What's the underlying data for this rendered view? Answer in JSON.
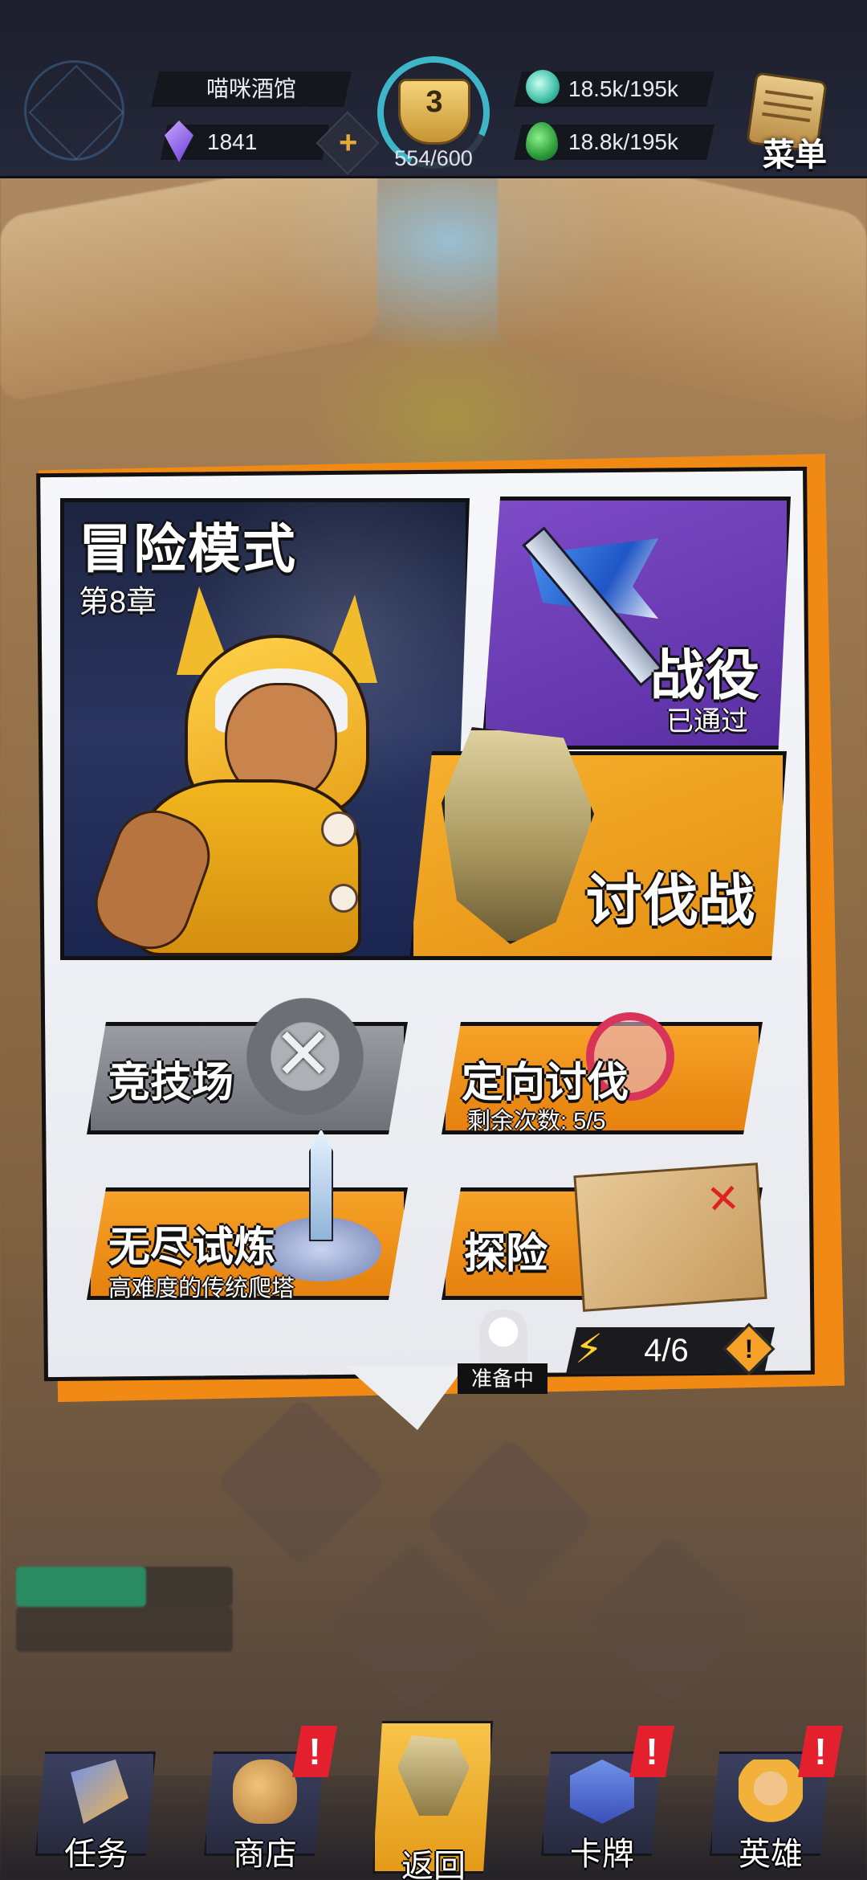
{
  "hud": {
    "tavern_name": "喵咪酒馆",
    "gems": "1841",
    "plus_label": "+",
    "trophy_level": "3",
    "trophy_progress": "554/600",
    "resource_1": "18.5k/195k",
    "resource_2": "18.8k/195k",
    "menu_label": "菜单"
  },
  "adventure": {
    "title": "冒险模式",
    "chapter": "第8章"
  },
  "campaign": {
    "title": "战役",
    "status": "已通过"
  },
  "subjugation": {
    "title": "讨伐战"
  },
  "modes": {
    "arena": {
      "label": "竞技场"
    },
    "directed": {
      "label": "定向讨伐",
      "sub": "剩余次数: 5/5"
    },
    "endless": {
      "label": "无尽试炼",
      "sub": "高难度的传统爬塔"
    },
    "explore": {
      "label": "探险"
    }
  },
  "ready": {
    "label": "准备中"
  },
  "stamina": {
    "icon": "⚡",
    "value": "4/6",
    "plus": "!"
  },
  "nav": {
    "items": [
      {
        "label": "任务",
        "icon": "quest-scroll-icon",
        "alert": false
      },
      {
        "label": "商店",
        "icon": "shop-bag-icon",
        "alert": true
      },
      {
        "label": "返回",
        "icon": "return-rock-icon",
        "alert": false,
        "active": true
      },
      {
        "label": "卡牌",
        "icon": "card-icon",
        "alert": true
      },
      {
        "label": "英雄",
        "icon": "hero-icon",
        "alert": true
      }
    ],
    "alert_mark": "!"
  },
  "colors": {
    "accent_orange": "#f08a14",
    "campaign_purple": "#6a3cb4",
    "hud_dark": "#1d1f2c",
    "alert_red": "#e4202e"
  }
}
